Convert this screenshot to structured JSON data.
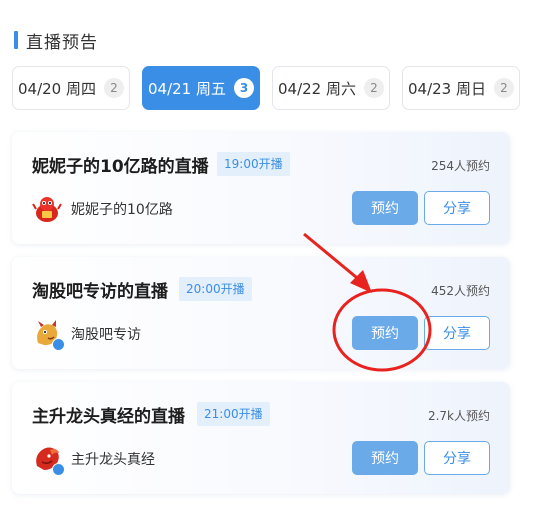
{
  "section": {
    "title": "直播预告"
  },
  "date_tabs": [
    {
      "label": "04/20 周四",
      "count": "2"
    },
    {
      "label": "04/21 周五",
      "count": "3",
      "active": true
    },
    {
      "label": "04/22 周六",
      "count": "2"
    },
    {
      "label": "04/23 周日",
      "count": "2"
    }
  ],
  "cards": [
    {
      "title": "妮妮子的10亿路的直播",
      "time": "19:00开播",
      "count": "254人预约",
      "host": "妮妮子的10亿路",
      "reserve_label": "预约",
      "share_label": "分享"
    },
    {
      "title": "淘股吧专访的直播",
      "time": "20:00开播",
      "count": "452人预约",
      "host": "淘股吧专访",
      "reserve_label": "预约",
      "share_label": "分享"
    },
    {
      "title": "主升龙头真经的直播",
      "time": "21:00开播",
      "count": "2.7k人预约",
      "host": "主升龙头真经",
      "reserve_label": "预约",
      "share_label": "分享"
    }
  ],
  "colors": {
    "accent": "#3a8ee6",
    "button": "#6aaae8",
    "annotation": "#e8231f"
  },
  "icons": {
    "avatar_1": "mascot-avatar-icon",
    "avatar_2": "dragon-avatar-icon",
    "avatar_3": "red-dragon-avatar-icon",
    "verified": "verified-badge-icon"
  }
}
